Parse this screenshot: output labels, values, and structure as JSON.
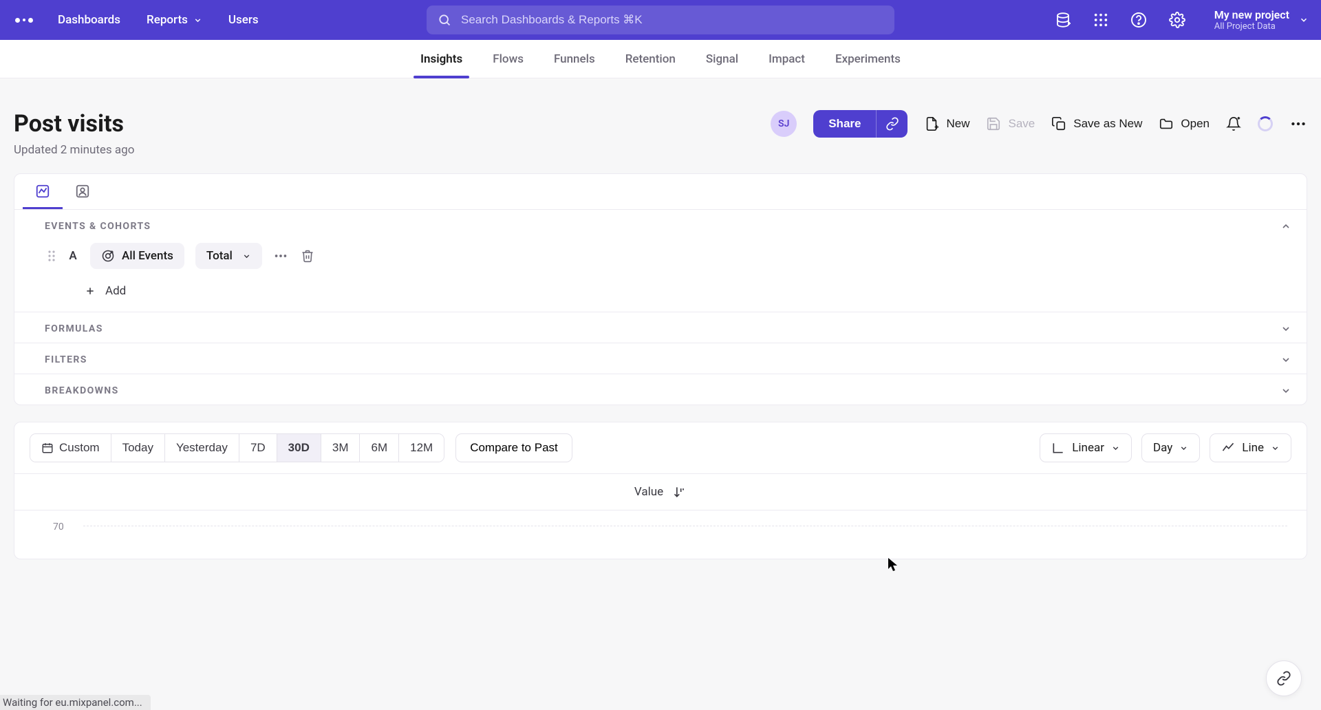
{
  "topnav": {
    "dashboards": "Dashboards",
    "reports": "Reports",
    "users": "Users"
  },
  "search": {
    "placeholder": "Search Dashboards & Reports ⌘K"
  },
  "project": {
    "name": "My new project",
    "scope": "All Project Data"
  },
  "tabs": {
    "insights": "Insights",
    "flows": "Flows",
    "funnels": "Funnels",
    "retention": "Retention",
    "signal": "Signal",
    "impact": "Impact",
    "experiments": "Experiments"
  },
  "page": {
    "title": "Post visits",
    "updated": "Updated 2 minutes ago"
  },
  "avatar": {
    "initials": "SJ"
  },
  "actions": {
    "share": "Share",
    "new": "New",
    "save": "Save",
    "save_as_new": "Save as New",
    "open": "Open"
  },
  "sections": {
    "events_cohorts": "EVENTS & COHORTS",
    "formulas": "FORMULAS",
    "filters": "FILTERS",
    "breakdowns": "BREAKDOWNS"
  },
  "event_row": {
    "series_label": "A",
    "event_name": "All Events",
    "measure": "Total",
    "add_label": "Add"
  },
  "time": {
    "custom": "Custom",
    "today": "Today",
    "yesterday": "Yesterday",
    "d7": "7D",
    "d30": "30D",
    "m3": "3M",
    "m6": "6M",
    "m12": "12M",
    "compare": "Compare to Past"
  },
  "chart_controls": {
    "scale": "Linear",
    "granularity": "Day",
    "type": "Line"
  },
  "value_label": "Value",
  "status": "Waiting for eu.mixpanel.com...",
  "chart_data": {
    "type": "line",
    "partial": true,
    "y_ticks_visible": [
      70
    ],
    "ylim_visible": [
      70,
      70
    ],
    "title": "Post visits",
    "xlabel": "",
    "ylabel": "Value",
    "series": []
  }
}
